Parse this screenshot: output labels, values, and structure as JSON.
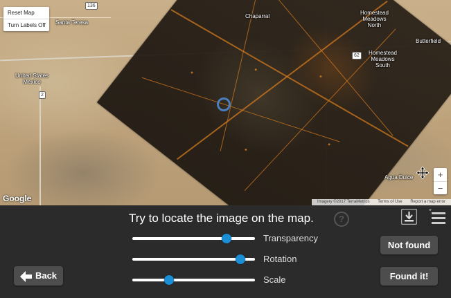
{
  "map": {
    "controls": {
      "reset_label": "Reset Map",
      "labels_toggle_label": "Turn Labels Off"
    },
    "places": [
      {
        "id": "santa-teresa",
        "name": "Santa Teresa"
      },
      {
        "id": "chaparral",
        "name": "Chaparral"
      },
      {
        "id": "homestead-north",
        "name": "Homestead\nMeadows\nNorth"
      },
      {
        "id": "butterfield",
        "name": "Butterfield"
      },
      {
        "id": "homestead-south",
        "name": "Homestead\nMeadows\nSouth"
      },
      {
        "id": "us-mexico",
        "name": "United States\nMexico"
      },
      {
        "id": "agua-dulce",
        "name": "Agua Dulce"
      }
    ],
    "route_shields": [
      "136",
      "62",
      "2"
    ],
    "google_logo": "Google",
    "attribution": [
      "Imagery ©2017 TerraMetrics",
      "Terms of Use",
      "Report a map error"
    ],
    "zoom_in": "+",
    "zoom_out": "−"
  },
  "panel": {
    "instruction": "Try to locate the image on the map.",
    "help_symbol": "?",
    "sliders": [
      {
        "label": "Transparency",
        "value": 0.77
      },
      {
        "label": "Rotation",
        "value": 0.88
      },
      {
        "label": "Scale",
        "value": 0.3
      }
    ],
    "not_found_label": "Not found",
    "found_label": "Found it!",
    "back_label": "Back"
  },
  "icons": [
    "help-icon",
    "download-icon",
    "menu-icon",
    "back-arrow-icon",
    "move-cursor-icon",
    "location-marker-icon"
  ],
  "colors": {
    "slider_thumb": "#1b8fd6",
    "button_bg": "#4d4d4d",
    "panel_bg": "#2b2b2b"
  }
}
